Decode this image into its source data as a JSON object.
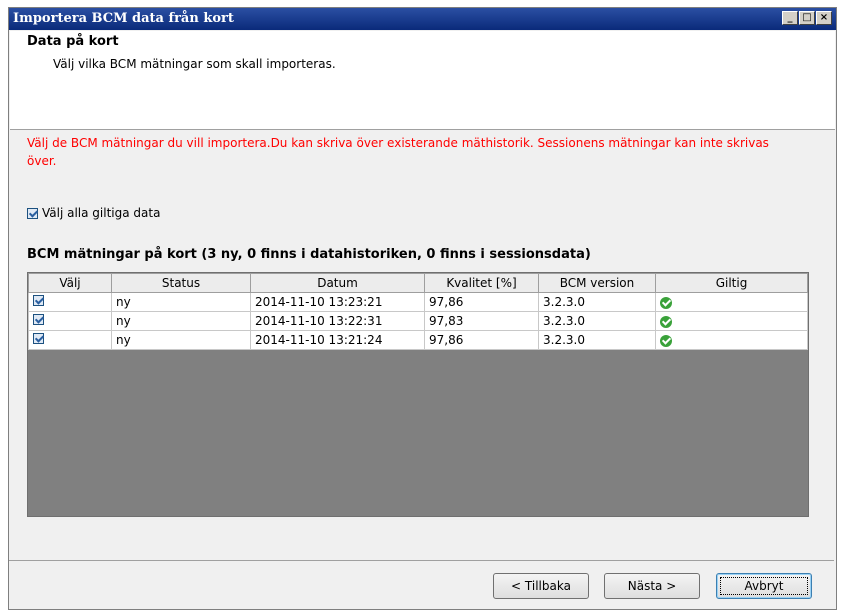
{
  "window": {
    "title": "Importera BCM data från kort",
    "controls": [
      "_",
      "□",
      "×"
    ]
  },
  "header": {
    "title": "Data på kort",
    "subtitle": "Välj vilka BCM mätningar som skall importeras."
  },
  "warning": "Välj de BCM mätningar du vill importera.Du kan skriva över existerande mäthistorik. Sessionens mätningar kan inte skrivas över.",
  "select_all": {
    "label": "Välj alla giltiga data",
    "checked": true
  },
  "table": {
    "title": "BCM mätningar på kort (3 ny, 0 finns i datahistoriken, 0 finns i sessionsdata)",
    "columns": [
      "Välj",
      "Status",
      "Datum",
      "Kvalitet [%]",
      "BCM version",
      "Giltig"
    ],
    "rows": [
      {
        "checked": true,
        "status": "ny",
        "datum": "2014-11-10 13:23:21",
        "kvalitet": "97,86",
        "version": "3.2.3.0",
        "giltig": "ok"
      },
      {
        "checked": true,
        "status": "ny",
        "datum": "2014-11-10 13:22:31",
        "kvalitet": "97,83",
        "version": "3.2.3.0",
        "giltig": "ok"
      },
      {
        "checked": true,
        "status": "ny",
        "datum": "2014-11-10 13:21:24",
        "kvalitet": "97,86",
        "version": "3.2.3.0",
        "giltig": "ok"
      }
    ]
  },
  "buttons": {
    "back": "< Tillbaka",
    "next": "Nästa >",
    "cancel": "Avbryt"
  },
  "colors": {
    "warning": "#ff0000",
    "titlebar": "#0a2a7a",
    "valid_icon": "#3aa23a"
  }
}
